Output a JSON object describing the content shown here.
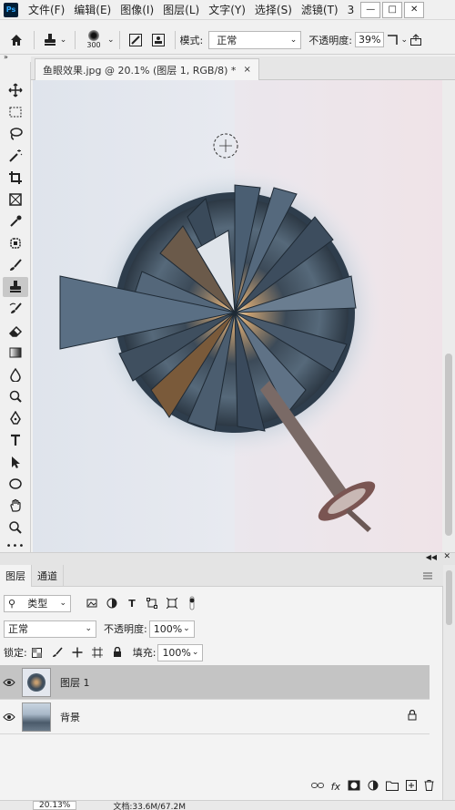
{
  "app": {
    "logo": "Ps"
  },
  "menu": {
    "items": [
      "文件(F)",
      "编辑(E)",
      "图像(I)",
      "图层(L)",
      "文字(Y)",
      "选择(S)",
      "滤镜(T)",
      "3"
    ],
    "window_buttons": [
      "minimize-icon",
      "restore-icon",
      "close-icon"
    ]
  },
  "options": {
    "brush_size": "300",
    "mode_label": "模式:",
    "mode_value": "正常",
    "opacity_label": "不透明度:",
    "opacity_value": "39%"
  },
  "document": {
    "tab_title": "鱼眼效果.jpg @ 20.1% (图层 1, RGB/8) *",
    "close": "×"
  },
  "tools": [
    "move-icon",
    "marquee-icon",
    "lasso-icon",
    "magic-wand-icon",
    "crop-icon",
    "frame-icon",
    "eyedropper-icon",
    "spot-healing-icon",
    "brush-icon",
    "clone-stamp-icon",
    "history-brush-icon",
    "eraser-icon",
    "gradient-icon",
    "blur-icon",
    "dodge-icon",
    "pen-icon",
    "type-icon",
    "path-select-icon",
    "ellipse-icon",
    "hand-icon",
    "zoom-icon",
    "more-icon"
  ],
  "active_tool": "clone-stamp-icon",
  "layers_panel": {
    "tabs": [
      "图层",
      "通道"
    ],
    "filter_kind": "类型",
    "blend_mode": "正常",
    "opacity_label": "不透明度:",
    "opacity_value": "100%",
    "lock_label": "锁定:",
    "fill_label": "填充:",
    "fill_value": "100%",
    "layers": [
      {
        "name": "图层 1",
        "selected": true
      },
      {
        "name": "背景",
        "selected": false,
        "locked": true
      }
    ],
    "footer_fx": "fx"
  },
  "status": {
    "zoom": "20.13%",
    "doc_info": "文档:33.6M/67.2M"
  },
  "colors": {
    "accent": "#31a8ff",
    "selected_layer": "#c4c4c4",
    "panel_bg": "#f3f3f3"
  }
}
